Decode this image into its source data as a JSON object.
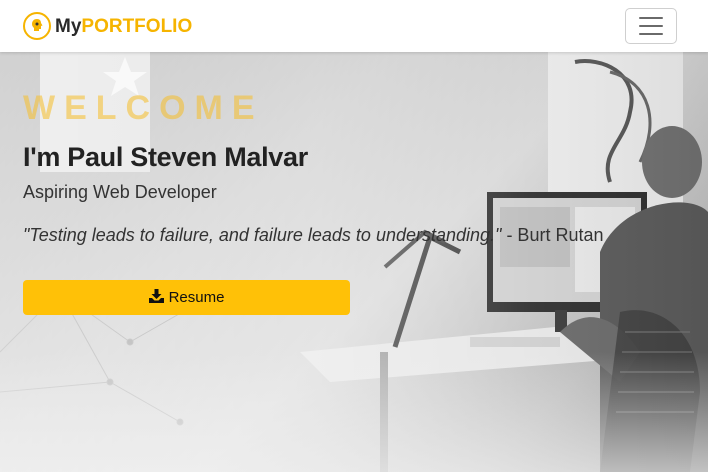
{
  "navbar": {
    "brand_prefix": "My",
    "brand_highlight": "PORTFOLIO",
    "logo_icon": "lightbulb-head-icon",
    "toggler_icon": "hamburger-icon"
  },
  "hero": {
    "welcome": "WELCOME",
    "name": "I'm Paul Steven Malvar",
    "role": "Aspiring Web Developer",
    "quote": "\"Testing leads to failure, and failure leads to understanding.\"",
    "quote_author": " - Burt Rutan",
    "resume_label": "Resume",
    "resume_icon": "download-icon"
  },
  "colors": {
    "accent": "#ffc107",
    "brand_yellow": "#f6b400",
    "text_dark": "#222222"
  }
}
